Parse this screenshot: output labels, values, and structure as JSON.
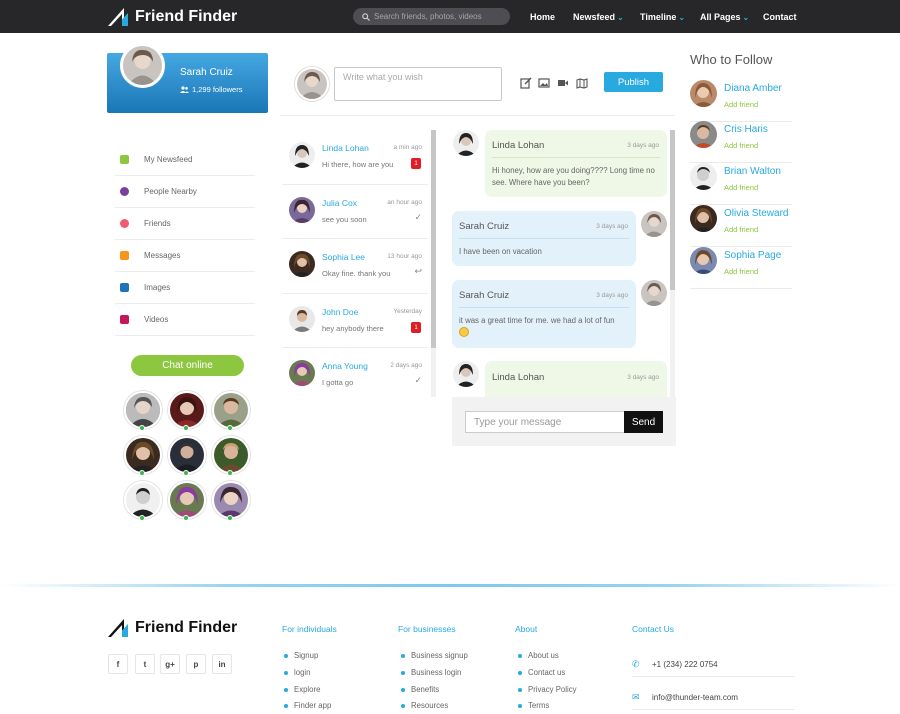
{
  "app": {
    "name": "Friend Finder"
  },
  "search": {
    "placeholder": "Search friends, photos, videos"
  },
  "nav": [
    {
      "label": "Home",
      "dropdown": false
    },
    {
      "label": "Newsfeed",
      "dropdown": true
    },
    {
      "label": "Timeline",
      "dropdown": true
    },
    {
      "label": "All Pages",
      "dropdown": true
    },
    {
      "label": "Contact",
      "dropdown": false
    }
  ],
  "profile": {
    "name": "Sarah Cruiz",
    "followers": "1,299 followers"
  },
  "sidebar": {
    "items": [
      {
        "label": "My Newsfeed",
        "icon": "newsfeed-icon",
        "color": "#8dc63f"
      },
      {
        "label": "People Nearby",
        "icon": "people-icon",
        "color": "#7a3f9d"
      },
      {
        "label": "Friends",
        "icon": "friends-icon",
        "color": "#f15a6f"
      },
      {
        "label": "Messages",
        "icon": "messages-icon",
        "color": "#f7941d"
      },
      {
        "label": "Images",
        "icon": "images-icon",
        "color": "#1c75bc"
      },
      {
        "label": "Videos",
        "icon": "videos-icon",
        "color": "#c2185b"
      }
    ]
  },
  "chat_online": {
    "label": "Chat online"
  },
  "composer": {
    "placeholder": "Write what you wish",
    "publish": "Publish"
  },
  "conversations": [
    {
      "name": "Linda Lohan",
      "time": "a min ago",
      "message": "Hi there, how are you",
      "badge": "1",
      "status": ""
    },
    {
      "name": "Julia Cox",
      "time": "an hour ago",
      "message": "see you soon",
      "badge": "",
      "status": "check"
    },
    {
      "name": "Sophia Lee",
      "time": "13 hour ago",
      "message": "Okay fine. thank you",
      "badge": "",
      "status": "reply"
    },
    {
      "name": "John Doe",
      "time": "Yesterday",
      "message": "hey anybody there",
      "badge": "1",
      "status": ""
    },
    {
      "name": "Anna Young",
      "time": "2 days ago",
      "message": "I gotta go",
      "badge": "",
      "status": "check"
    }
  ],
  "messages": [
    {
      "name": "Linda Lohan",
      "time": "3 days ago",
      "text": "Hi honey, how are you doing???? Long time no see. Where have you been?"
    },
    {
      "name": "Sarah Cruiz",
      "time": "3 days ago",
      "text": "I have been on vacation"
    },
    {
      "name": "Sarah Cruiz",
      "time": "3 days ago",
      "text": "it was a great time for me. we had a lot of fun"
    },
    {
      "name": "Linda Lohan",
      "time": "3 days ago",
      "text": ""
    }
  ],
  "chat_input": {
    "placeholder": "Type your message",
    "send": "Send"
  },
  "who_to_follow": {
    "title": "Who to Follow",
    "people": [
      {
        "name": "Diana Amber",
        "action": "Add friend"
      },
      {
        "name": "Cris Haris",
        "action": "Add friend"
      },
      {
        "name": "Brian Walton",
        "action": "Add friend"
      },
      {
        "name": "Olivia Steward",
        "action": "Add friend"
      },
      {
        "name": "Sophia Page",
        "action": "Add friend"
      }
    ]
  },
  "footer": {
    "brand": "Friend Finder",
    "social": [
      "f",
      "t",
      "g+",
      "p",
      "in"
    ],
    "columns": [
      {
        "title": "For individuals",
        "links": [
          "Signup",
          "login",
          "Explore",
          "Finder app"
        ]
      },
      {
        "title": "For businesses",
        "links": [
          "Business signup",
          "Business login",
          "Benefits",
          "Resources"
        ]
      },
      {
        "title": "About",
        "links": [
          "About us",
          "Contact us",
          "Privacy Policy",
          "Terms"
        ]
      }
    ],
    "contact": {
      "title": "Contact Us",
      "phone": "+1 (234) 222 0754",
      "email": "info@thunder-team.com"
    }
  },
  "colors": {
    "accent": "#28a9e0",
    "green": "#8dc63f",
    "topbar": "#27272a",
    "badge": "#e11c24"
  }
}
